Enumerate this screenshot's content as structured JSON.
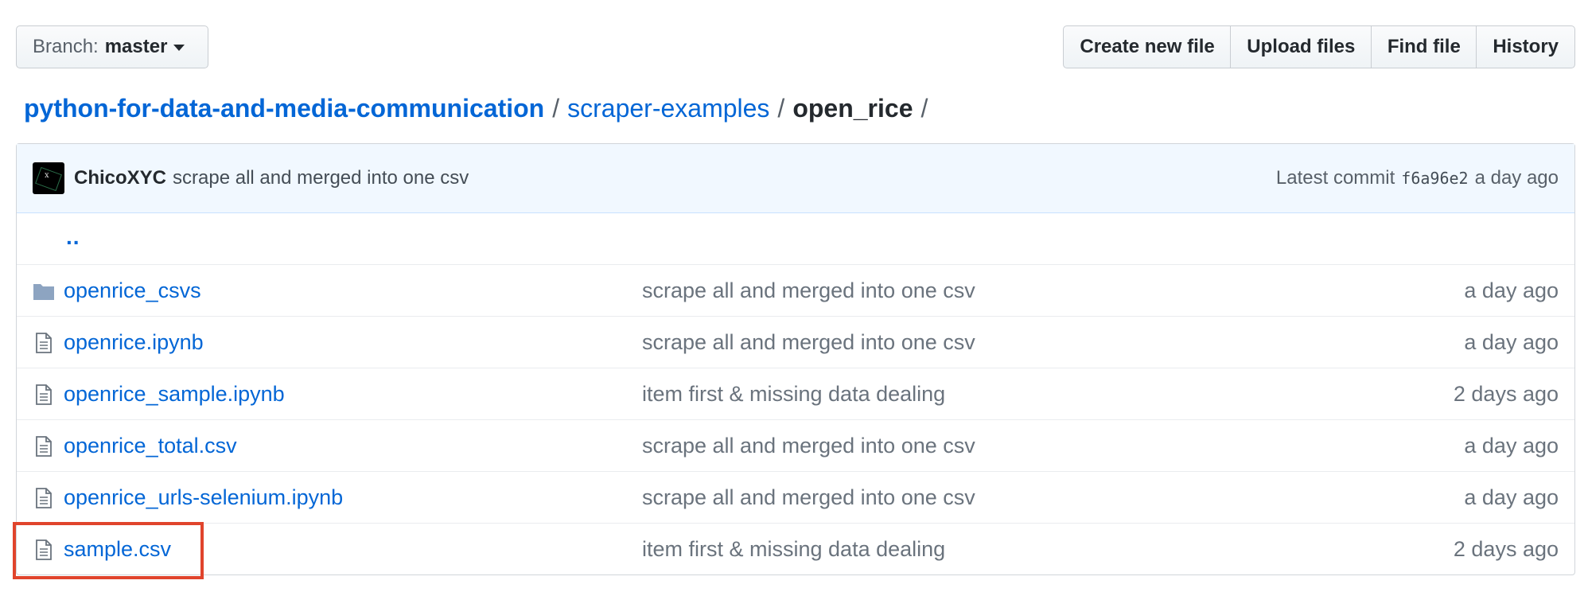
{
  "branch": {
    "prefix": "Branch:",
    "name": "master"
  },
  "actions": [
    "Create new file",
    "Upload files",
    "Find file",
    "History"
  ],
  "breadcrumb": {
    "repo": "python-for-data-and-media-communication",
    "folder": "scraper-examples",
    "current": "open_rice",
    "separator": "/"
  },
  "commit": {
    "author": "ChicoXYC",
    "message": "scrape all and merged into one csv",
    "latest_label": "Latest commit",
    "sha": "f6a96e2",
    "age": "a day ago"
  },
  "parent_link": "..",
  "files": [
    {
      "type": "folder",
      "name": "openrice_csvs",
      "message": "scrape all and merged into one csv",
      "age": "a day ago"
    },
    {
      "type": "file",
      "name": "openrice.ipynb",
      "message": "scrape all and merged into one csv",
      "age": "a day ago"
    },
    {
      "type": "file",
      "name": "openrice_sample.ipynb",
      "message": "item first & missing data dealing",
      "age": "2 days ago"
    },
    {
      "type": "file",
      "name": "openrice_total.csv",
      "message": "scrape all and merged into one csv",
      "age": "a day ago"
    },
    {
      "type": "file",
      "name": "openrice_urls-selenium.ipynb",
      "message": "scrape all and merged into one csv",
      "age": "a day ago"
    },
    {
      "type": "file",
      "name": "sample.csv",
      "message": "item first & missing data dealing",
      "age": "2 days ago"
    }
  ],
  "colors": {
    "link": "#0366d6",
    "highlight": "#e0442c",
    "folder_icon": "#79b8ff"
  }
}
